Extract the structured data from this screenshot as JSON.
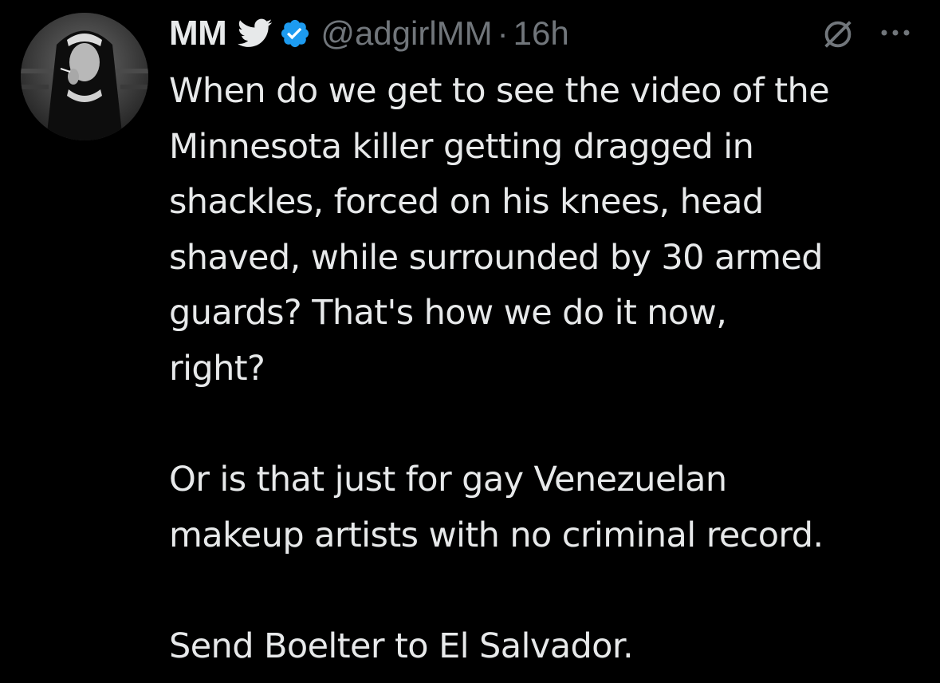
{
  "tweet": {
    "display_name": "MM",
    "handle": "@adgirlMM",
    "separator": "·",
    "time": "16h",
    "icons": {
      "avatar": "avatar-photo",
      "bird": "twitter-bird-icon",
      "verified": "verified-badge-icon",
      "grok": "grok-icon",
      "more": "more-options-icon"
    },
    "colors": {
      "background": "#000000",
      "text": "#e7e9ea",
      "secondary": "#71767b",
      "verified": "#1d9bf0"
    },
    "paragraphs": [
      {
        "lines": [
          "When do we get to see the video of the",
          "Minnesota killer getting dragged in",
          "shackles, forced on his knees, head",
          "shaved, while surrounded by 30 armed",
          "guards? That's how we do it now,",
          "right?"
        ]
      },
      {
        "lines": [
          "Or is that just for gay Venezuelan",
          "makeup artists with no criminal record."
        ]
      },
      {
        "lines": [
          "Send Boelter to El Salvador."
        ]
      }
    ]
  }
}
